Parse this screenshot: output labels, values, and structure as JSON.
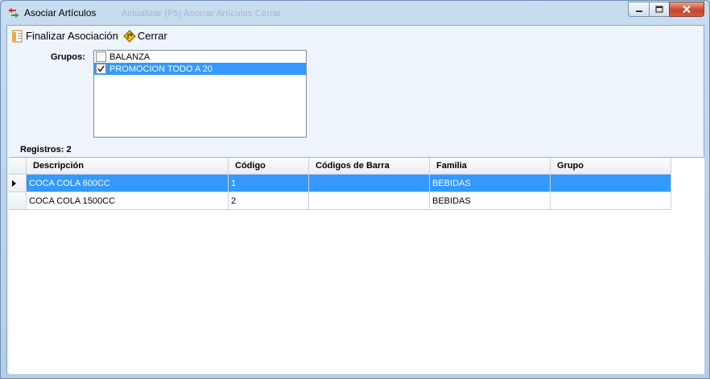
{
  "window": {
    "title": "Asociar Artículos",
    "background_ghost_text": "Actualizar (F5)  Asociar Artículos  Cerrar"
  },
  "toolbar": {
    "finalize_label": "Finalizar Asociación",
    "close_label": "Cerrar"
  },
  "groups": {
    "label": "Grupos:",
    "items": [
      {
        "label": "BALANZA",
        "checked": false,
        "selected": false
      },
      {
        "label": "PROMOCION TODO A 20",
        "checked": true,
        "selected": true
      }
    ]
  },
  "records": {
    "label": "Registros: 2"
  },
  "grid": {
    "columns": [
      "Descripción",
      "Código",
      "Códigos de Barra",
      "Familia",
      "Grupo"
    ],
    "rows": [
      {
        "descripcion": "COCA COLA 600CC",
        "codigo": "1",
        "codigos_barra": "",
        "familia": "BEBIDAS",
        "grupo": "",
        "selected": true
      },
      {
        "descripcion": "COCA COLA 1500CC",
        "codigo": "2",
        "codigos_barra": "",
        "familia": "BEBIDAS",
        "grupo": "",
        "selected": false
      }
    ]
  },
  "colors": {
    "selection": "#3399ff",
    "window_frame": "#bcd3ea",
    "close_button": "#c9452c"
  }
}
